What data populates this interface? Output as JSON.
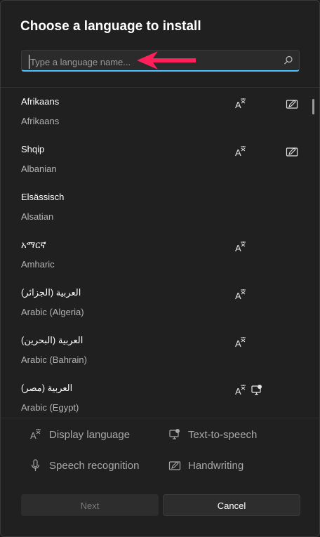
{
  "dialog": {
    "title": "Choose a language to install",
    "search_placeholder": "Type a language name...",
    "search_value": ""
  },
  "languages": [
    {
      "native": "Afrikaans",
      "english": "Afrikaans",
      "features": [
        "display-language-icon",
        "handwriting-icon"
      ]
    },
    {
      "native": "Shqip",
      "english": "Albanian",
      "features": [
        "display-language-icon",
        "handwriting-icon"
      ]
    },
    {
      "native": "Elsässisch",
      "english": "Alsatian",
      "features": []
    },
    {
      "native": "አማርኛ",
      "english": "Amharic",
      "features": [
        "display-language-icon"
      ]
    },
    {
      "native": "العربية (الجزائر)",
      "english": "Arabic (Algeria)",
      "features": [
        "display-language-icon"
      ]
    },
    {
      "native": "العربية (البحرين)",
      "english": "Arabic (Bahrain)",
      "features": [
        "display-language-icon"
      ]
    },
    {
      "native": "العربية (مصر)",
      "english": "Arabic (Egypt)",
      "features": [
        "display-language-icon",
        "text-to-speech-icon"
      ]
    }
  ],
  "legend": {
    "display_language": "Display language",
    "text_to_speech": "Text-to-speech",
    "speech_recognition": "Speech recognition",
    "handwriting": "Handwriting"
  },
  "buttons": {
    "next": "Next",
    "cancel": "Cancel"
  },
  "colors": {
    "accent": "#4cc2ff",
    "annotation_arrow": "#ff1f5a",
    "background": "#202020"
  }
}
